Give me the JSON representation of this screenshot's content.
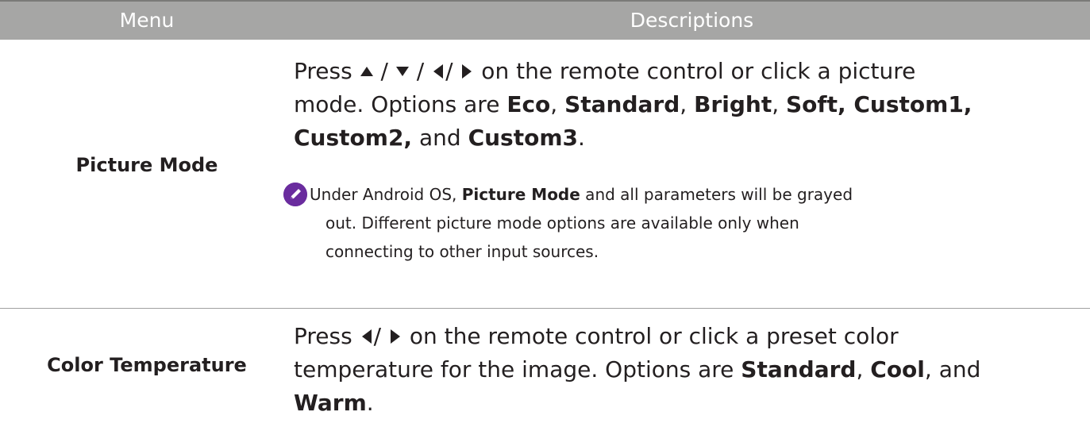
{
  "header": {
    "menu_label": "Menu",
    "desc_label": "Descriptions"
  },
  "rows": [
    {
      "menu": "Picture Mode",
      "line1_pre": "Press ",
      "sep1": " / ",
      "sep2": " / ",
      "sep3": "/ ",
      "line1_post": " on the remote control or click a picture",
      "line2_pre": "mode. Options are ",
      "opt_eco": "Eco",
      "comma1": ", ",
      "opt_standard": "Standard",
      "comma2": ", ",
      "opt_bright": "Bright",
      "comma3": ", ",
      "opt_soft": "Soft, Custom1,",
      "opt_custom2": "Custom2,",
      "and": " and ",
      "opt_custom3": "Custom3",
      "end": ".",
      "note": {
        "icon": "pencil-note-icon",
        "icon_color": "#6a2c9e",
        "pre": "Under Android OS, ",
        "bold": "Picture Mode",
        "post": " and all parameters will be grayed",
        "line2": "out. Different picture mode options are available only when",
        "line3": "connecting to other input sources."
      }
    },
    {
      "menu": "Color Temperature",
      "line1_pre": "Press ",
      "sep1": "/ ",
      "line1_post": " on the remote control or click a preset color",
      "line2_pre": "temperature for the image. Options are ",
      "opt_standard": "Standard",
      "comma1": ", ",
      "opt_cool": "Cool",
      "comma2": ", and",
      "opt_warm": "Warm",
      "end": "."
    }
  ],
  "icons": {
    "up": "triangle-up-icon",
    "down": "triangle-down-icon",
    "left": "triangle-left-icon",
    "right": "triangle-right-icon"
  },
  "colors": {
    "header_bg": "#a6a6a5",
    "header_text": "#ffffff",
    "text": "#231f20"
  }
}
